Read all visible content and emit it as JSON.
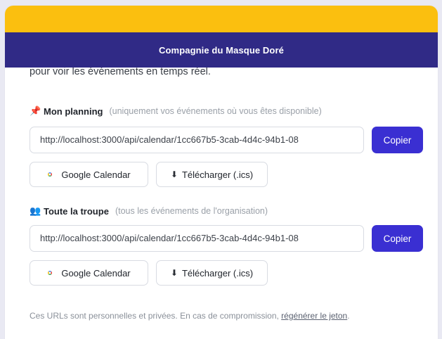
{
  "header": {
    "brand": "Compagnie du Masque Doré"
  },
  "intro": {
    "line2": "pour voir les événements en temps réel."
  },
  "sections": [
    {
      "icon": "📌",
      "title": "Mon planning",
      "hint": "(uniquement vos événements où vous êtes disponible)",
      "url": "http://localhost:3000/api/calendar/1cc667b5-3cab-4d4c-94b1-08",
      "copy_label": "Copier",
      "google_label": "Google Calendar",
      "download_label": "Télécharger (.ics)"
    },
    {
      "icon": "👥",
      "title": "Toute la troupe",
      "hint": "(tous les événements de l'organisation)",
      "url": "http://localhost:3000/api/calendar/1cc667b5-3cab-4d4c-94b1-08",
      "copy_label": "Copier",
      "google_label": "Google Calendar",
      "download_label": "Télécharger (.ics)"
    }
  ],
  "footer": {
    "note": "Ces URLs sont personnelles et privées. En cas de compromission,",
    "link": "régénérer le jeton",
    "period": "."
  },
  "colors": {
    "top_bar": "#fbbf0f",
    "brand_bar": "#302a86",
    "primary_button": "#3a2fd2"
  },
  "icons": {
    "pin": "pin-icon",
    "group": "group-icon",
    "google": "google-icon",
    "download": "download-icon"
  }
}
